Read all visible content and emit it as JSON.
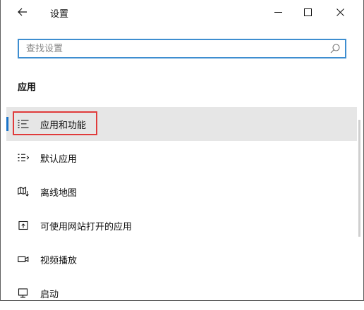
{
  "titlebar": {
    "title": "设置",
    "back_icon": "arrow-left",
    "minimize_icon": "minimize",
    "maximize_icon": "maximize",
    "close_icon": "close"
  },
  "search": {
    "placeholder": "查找设置",
    "value": "",
    "icon": "search-icon"
  },
  "section": {
    "heading": "应用"
  },
  "nav": {
    "items": [
      {
        "label": "应用和功能",
        "icon": "list-icon",
        "selected": true
      },
      {
        "label": "默认应用",
        "icon": "default-apps-icon",
        "selected": false
      },
      {
        "label": "离线地图",
        "icon": "map-icon",
        "selected": false
      },
      {
        "label": "可使用网站打开的应用",
        "icon": "open-in-app-icon",
        "selected": false
      },
      {
        "label": "视频播放",
        "icon": "video-icon",
        "selected": false
      },
      {
        "label": "启动",
        "icon": "startup-icon",
        "selected": false
      }
    ]
  },
  "colors": {
    "accent": "#1a73c8",
    "search_border": "#3e8ed0",
    "highlight_frame": "#e03b3b",
    "selected_bg": "#e6e6e6"
  }
}
